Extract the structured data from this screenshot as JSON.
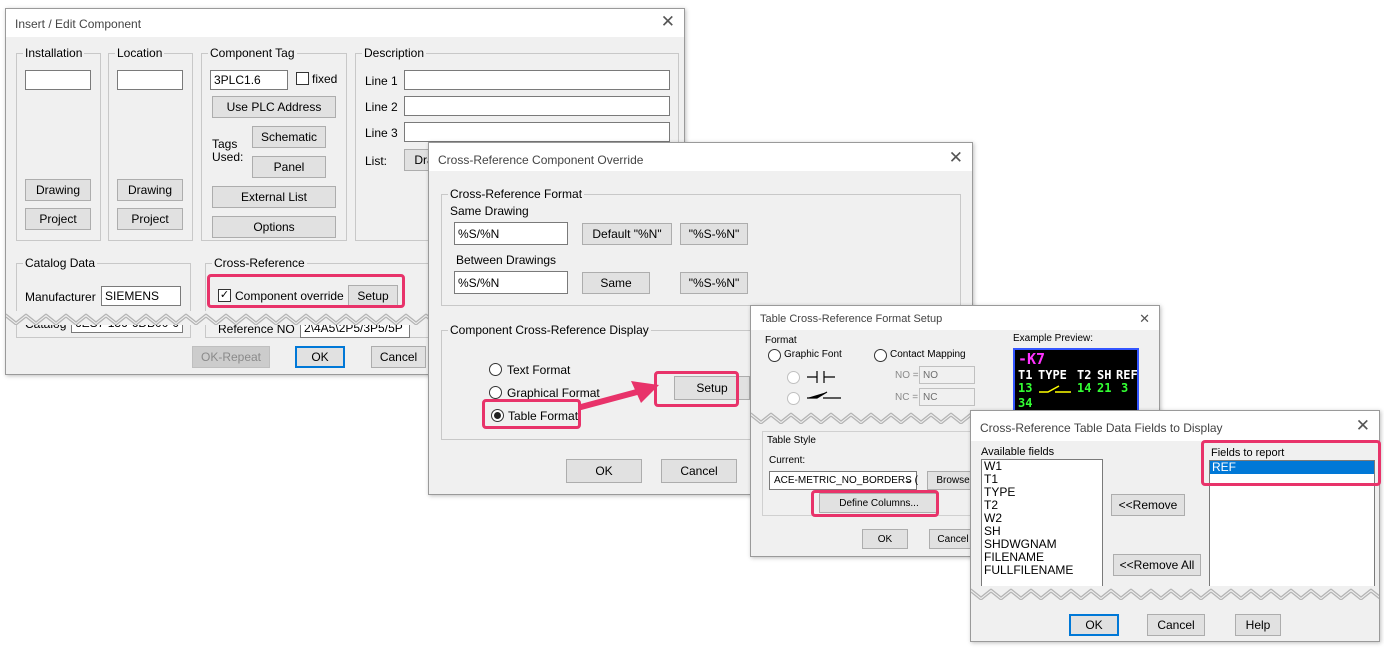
{
  "dialog1": {
    "title": "Insert / Edit Component",
    "installation_label": "Installation",
    "location_label": "Location",
    "drawing_btn": "Drawing",
    "project_btn": "Project",
    "component_tag_label": "Component Tag",
    "tag_value": "3PLC1.6",
    "fixed_label": "fixed",
    "use_plc_btn": "Use PLC Address",
    "tags_used_label": "Tags\nUsed:",
    "schematic_btn": "Schematic",
    "panel_btn": "Panel",
    "external_list_btn": "External List",
    "options_btn": "Options",
    "description_label": "Description",
    "line1": "Line 1",
    "line2": "Line 2",
    "line3": "Line 3",
    "list_label": "List:",
    "list_btn_partial": "Dra",
    "catalog_data_label": "Catalog Data",
    "manufacturer_label": "Manufacturer",
    "manufacturer_value": "SIEMENS",
    "catalog_label": "Catalog",
    "catalog_value": "6ES7 136-6DB00-0C",
    "cross_reference_label": "Cross-Reference",
    "component_override_label": "Component override",
    "setup_btn": "Setup",
    "reference_label_partial": "Reference NO",
    "reference_value_partial": "2\\4A5\\2P5/3P5/5P",
    "ok_repeat_btn": "OK-Repeat",
    "ok_btn": "OK",
    "cancel_btn": "Cancel"
  },
  "dialog2": {
    "title": "Cross-Reference Component Override",
    "format_group_label": "Cross-Reference Format",
    "same_drawing_label": "Same Drawing",
    "same_drawing_value": "%S/%N",
    "default_btn": "Default \"%N\"",
    "sn_btn": "\"%S-%N\"",
    "between_drawings_label": "Between Drawings",
    "between_drawings_value": "%S/%N",
    "same_btn": "Same",
    "sn_btn2": "\"%S-%N\"",
    "display_group_label": "Component Cross-Reference Display",
    "text_format_label": "Text Format",
    "graphical_format_label": "Graphical Format",
    "table_format_label": "Table Format",
    "setup_btn": "Setup",
    "ok_btn": "OK",
    "cancel_btn": "Cancel"
  },
  "dialog3": {
    "title": "Table Cross-Reference Format Setup",
    "format_label": "Format",
    "graphic_font_label": "Graphic Font",
    "contact_mapping_label": "Contact Mapping",
    "no_label": "NO =",
    "no_value": "NO",
    "nc_label": "NC =",
    "nc_value": "NC",
    "example_preview_label": "Example Preview:",
    "preview": {
      "tag": "-K7",
      "headers": [
        "T1",
        "TYPE",
        "T2",
        "SH",
        "REF"
      ],
      "row1": [
        "13",
        "14",
        "21",
        "3"
      ],
      "row2_partial": "34"
    },
    "table_style_label": "Table Style",
    "current_label": "Current:",
    "current_value": "ACE-METRIC_NO_BORDERS  (",
    "browse_btn": "Browse",
    "define_columns_btn": "Define Columns...",
    "ok_btn": "OK",
    "cancel_btn": "Cancel"
  },
  "dialog4": {
    "title": "Cross-Reference Table Data Fields to Display",
    "available_label": "Available fields",
    "available_fields": [
      "W1",
      "T1",
      "TYPE",
      "T2",
      "W2",
      "SH",
      "SHDWGNAM",
      "FILENAME",
      "FULLFILENAME"
    ],
    "remove_btn": "<<Remove",
    "remove_all_btn": "<<Remove All",
    "report_label": "Fields to report",
    "report_fields": [
      "REF"
    ],
    "ok_btn": "OK",
    "cancel_btn": "Cancel",
    "help_btn": "Help"
  },
  "colors": {
    "highlight": "#e8336a",
    "selection": "#0078d7",
    "default_button_border": "#0078d7",
    "preview_tag": "#ff33ff",
    "preview_header": "#ffffff",
    "preview_values": "#33ff33",
    "preview_contact": "#ffff00"
  }
}
